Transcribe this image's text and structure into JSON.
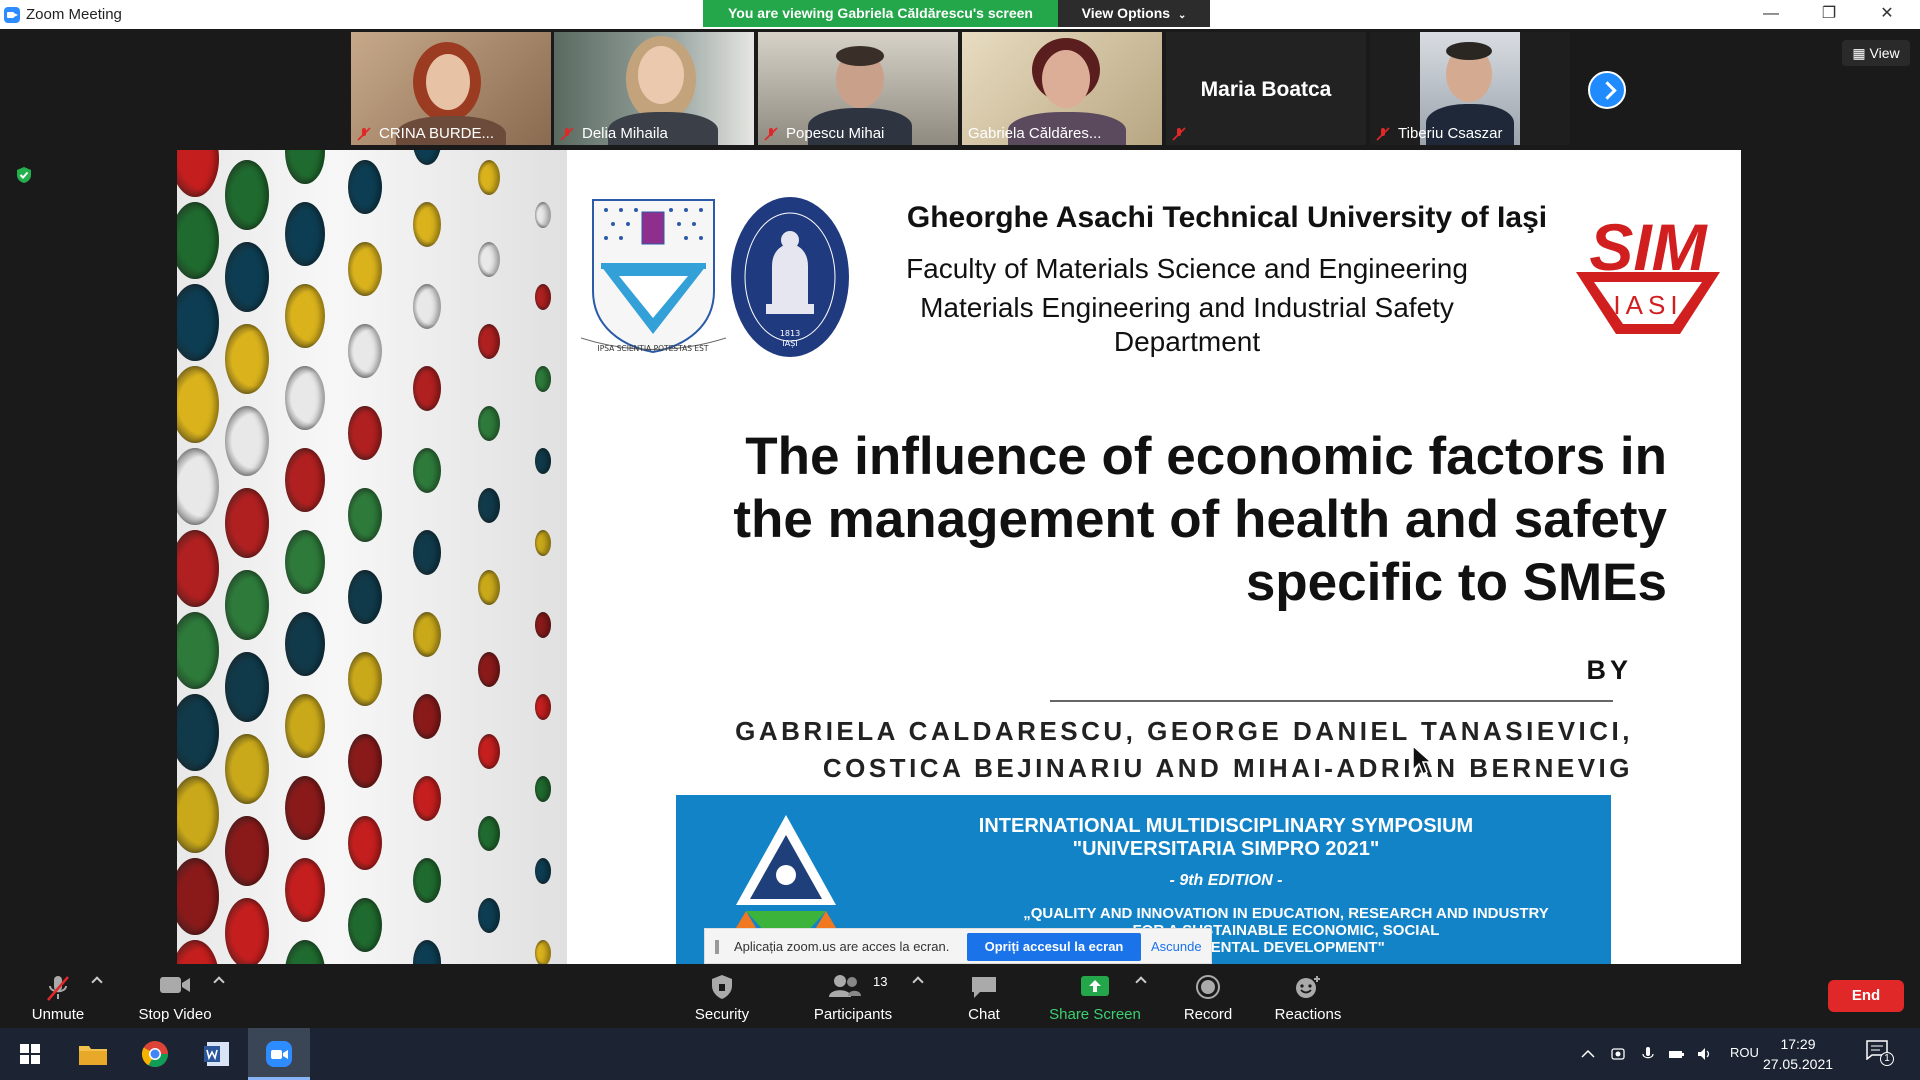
{
  "window": {
    "title": "Zoom Meeting",
    "share_banner": "You are viewing Gabriela Căldărescu's screen",
    "view_options": "View Options",
    "view_label": "View",
    "minimize": "—",
    "restore": "❐",
    "close": "✕"
  },
  "participants": [
    {
      "name": "CRINA BURDE...",
      "muted": true
    },
    {
      "name": "Delia Mihaila",
      "muted": true
    },
    {
      "name": "Popescu Mihai",
      "muted": true
    },
    {
      "name": "Gabriela Căldăres...",
      "muted": false,
      "active": true
    },
    {
      "name": "Maria Boatca",
      "muted": true,
      "video": false
    },
    {
      "name": "Tiberiu Csaszar",
      "muted": true
    }
  ],
  "slide": {
    "university": "Gheorghe Asachi Technical University of Iaşi",
    "faculty": "Faculty of Materials Science and Engineering",
    "department_line1": "Materials Engineering and Industrial Safety",
    "department_line2": "Department",
    "title_line1": "The influence of economic factors in",
    "title_line2": "the management of health and safety",
    "title_line3": "specific to SMEs",
    "by": "BY",
    "authors_line1": "GABRIELA CALDARESCU, GEORGE DANIEL TANASIEVICI,",
    "authors_line2": "COSTICA BEJINARIU AND MIHAI-ADRIAN BERNEVIG",
    "sim_logo_text": "SIM",
    "sim_logo_sub": "IASI",
    "logo1_motto": "IPSA SCIENTIA POTESTAS EST",
    "logo2_year": "1813",
    "logo2_city": "IAȘI",
    "symposium_line1": "INTERNATIONAL MULTIDISCIPLINARY SYMPOSIUM",
    "symposium_line2": "\"UNIVERSITARIA SIMPRO 2021\"",
    "symposium_edition": "- 9th EDITION -",
    "symposium_theme1": "„QUALITY AND INNOVATION IN EDUCATION, RESEARCH AND INDUSTRY",
    "symposium_theme2": "FOR A SUSTAINABLE ECONOMIC, SOCIAL",
    "symposium_theme3": "NMENTAL DEVELOPMENT\""
  },
  "notification": {
    "message": "Aplicația zoom.us are acces la ecran.",
    "stop_label": "Opriți accesul la ecran",
    "hide_label": "Ascunde"
  },
  "toolbar": {
    "unmute": "Unmute",
    "stop_video": "Stop Video",
    "security": "Security",
    "participants": "Participants",
    "participants_count": "13",
    "chat": "Chat",
    "share_screen": "Share Screen",
    "record": "Record",
    "reactions": "Reactions",
    "end": "End"
  },
  "taskbar": {
    "time": "17:29",
    "date": "27.05.2021",
    "language": "ROU",
    "notification_count": "1"
  },
  "colors": {
    "share_green": "#24a64a",
    "accent_blue": "#1f8bff",
    "end_red": "#e02828",
    "muted_red": "#e02828"
  }
}
